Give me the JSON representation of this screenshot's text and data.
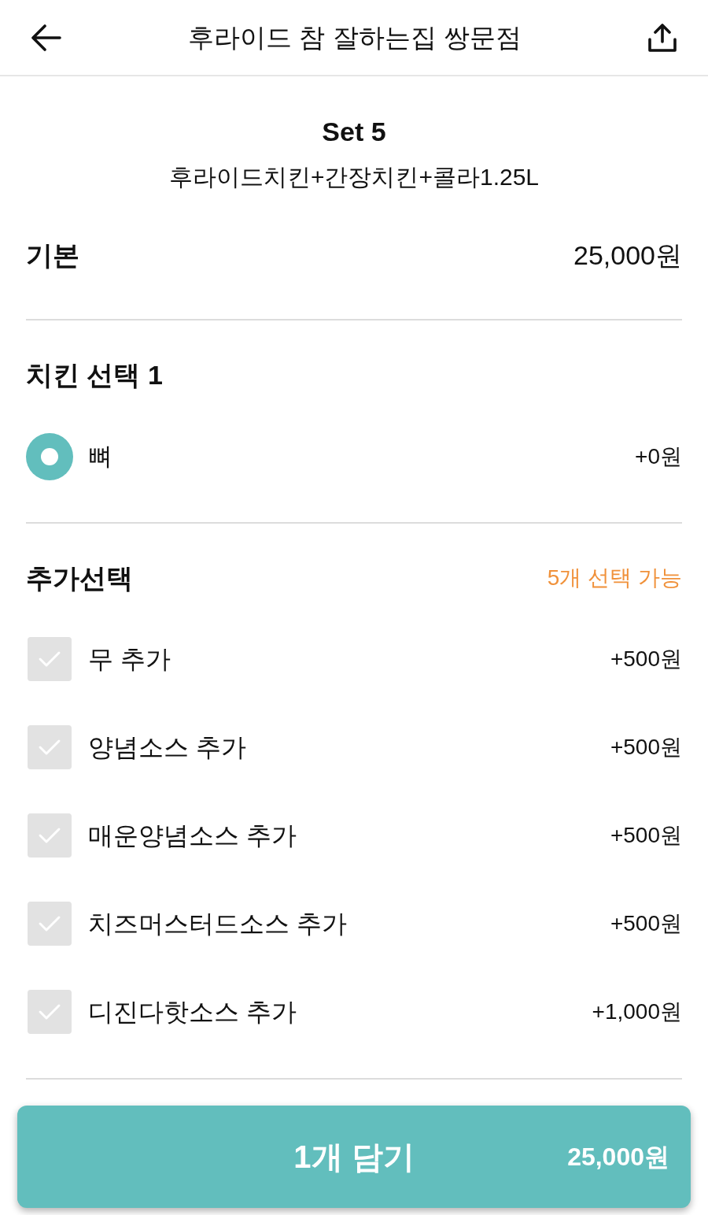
{
  "header": {
    "title": "후라이드 참 잘하는집 쌍문점"
  },
  "menu": {
    "name": "Set 5",
    "description": "후라이드치킨+간장치킨+콜라1.25L"
  },
  "base": {
    "label": "기본",
    "price": "25,000원"
  },
  "chicken_choice": {
    "title": "치킨 선택 1",
    "options": [
      {
        "label": "뼈",
        "price": "+0원",
        "selected": true
      }
    ]
  },
  "extras": {
    "title": "추가선택",
    "limit": "5개 선택 가능",
    "options": [
      {
        "label": "무 추가",
        "price": "+500원",
        "checked": false
      },
      {
        "label": "양념소스 추가",
        "price": "+500원",
        "checked": false
      },
      {
        "label": "매운양념소스 추가",
        "price": "+500원",
        "checked": false
      },
      {
        "label": "치즈머스터드소스 추가",
        "price": "+500원",
        "checked": false
      },
      {
        "label": "디진다핫소스 추가",
        "price": "+1,000원",
        "checked": false
      }
    ]
  },
  "cart_button": {
    "label": "1개 담기",
    "price": "25,000원"
  }
}
